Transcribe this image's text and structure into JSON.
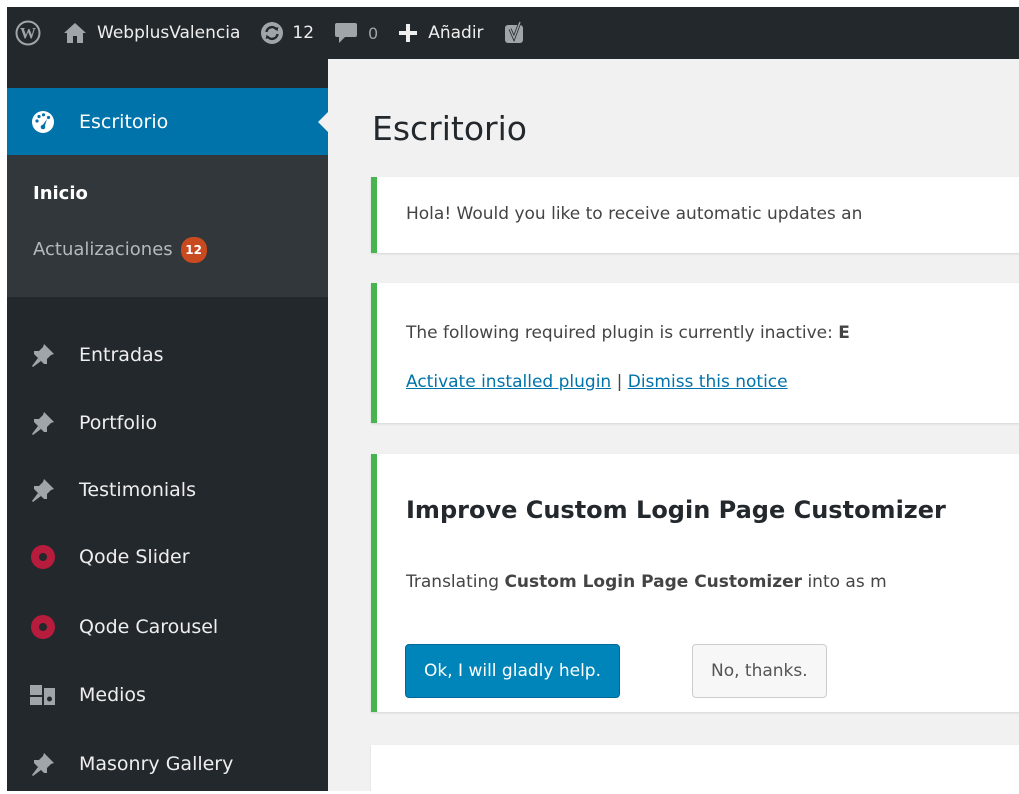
{
  "adminbar": {
    "site_name": "WebplusValencia",
    "updates_count": "12",
    "comments_count": "0",
    "new_label": "Añadir"
  },
  "sidebar": {
    "current": "Escritorio",
    "submenu": [
      {
        "label": "Inicio"
      },
      {
        "label": "Actualizaciones",
        "badge": "12"
      }
    ],
    "items": [
      {
        "label": "Entradas",
        "icon": "pin-icon"
      },
      {
        "label": "Portfolio",
        "icon": "pin-icon"
      },
      {
        "label": "Testimonials",
        "icon": "pin-icon"
      },
      {
        "label": "Qode Slider",
        "icon": "qode-icon"
      },
      {
        "label": "Qode Carousel",
        "icon": "qode-icon"
      },
      {
        "label": "Medios",
        "icon": "media-icon"
      },
      {
        "label": "Masonry Gallery",
        "icon": "pin-icon"
      }
    ]
  },
  "main": {
    "title": "Escritorio",
    "notice1": {
      "text": "Hola! Would you like to receive automatic updates an"
    },
    "notice2": {
      "text_prefix": "The following required plugin is currently inactive: ",
      "text_bold": "E",
      "activate_link": "Activate installed plugin",
      "separator": " | ",
      "dismiss_link": "Dismiss this notice"
    },
    "notice3": {
      "heading": "Improve Custom Login Page Customizer",
      "text_prefix": "Translating ",
      "text_bold": "Custom Login Page Customizer",
      "text_suffix": " into as m",
      "ok_button": "Ok, I will gladly help.",
      "no_button": "No, thanks."
    }
  },
  "colors": {
    "admin_dark": "#23282d",
    "submenu_bg": "#32373c",
    "accent_blue": "#0073aa",
    "notice_green": "#46b450",
    "badge_orange": "#ca4a1f",
    "qode_red": "#b81c3c"
  }
}
